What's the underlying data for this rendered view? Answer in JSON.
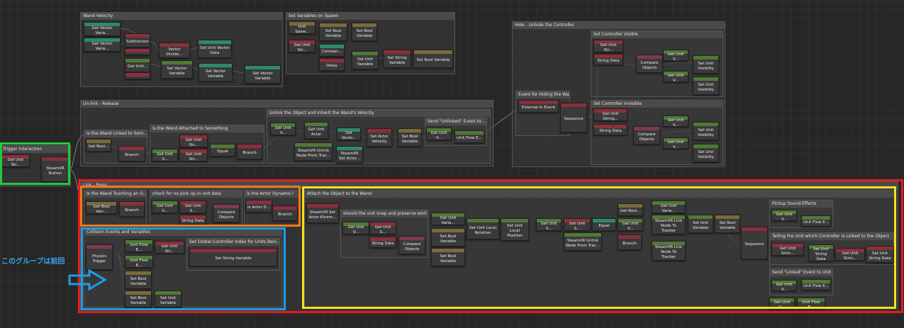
{
  "groups": {
    "wand_velocity": "Wand Velocity",
    "set_vars_spawn": "Set Variables on Spawn",
    "hide_unhide": "Hide - Unhide the Controller",
    "set_controller_visible": "Set Controller Visible",
    "set_controller_invisible": "Set Controller Invisible",
    "unlink_release": "Un-link - Release",
    "is_wand_linked": "Is the Wand Linked to Som...",
    "is_wand_attached": "Is the Wand Attached to Something",
    "unlink_inherit": "Unlink the Object and Inherit the Wand's Velocity",
    "send_unlinked": "Send \"Unlinked\" Event to...",
    "trigger_interaction": "Trigger Interaction",
    "link_press": "Link - Press",
    "is_wand_touching": "Is the Wand Touching an O...",
    "check_no_pickup": "check for no pick up in unit data",
    "is_actor_dynamic": "Is the Actor Dynamic?",
    "attach_object": "Attach the Object to the Wand",
    "should_snap": "should the unit snap and preserve worl...",
    "pickup_sound": "Pickup Sound Effects",
    "telling_unit": "Telling the Unit which Controller is Linked to the Object",
    "send_linked": "Send \"Linked\" Event to Unit",
    "collision": "Collision Events and Variables",
    "set_global_controller": "Set Global Controller Index for Units Bein..."
  },
  "nodes": {
    "get_vector_var": "Get Vector Varia...",
    "get_vector_var2": "Get Vector Varia...",
    "subtraction": "Subtraction",
    "vector_divide": "Vector Divide...",
    "set_unit_vector_data": "Set Unit Vector Data",
    "get_unit": "Get Unit...",
    "set_vector_variable": "Set Vector Variable",
    "unit_spawn": "Unit Spaw...",
    "get_unit_str": "Get Unit Str...",
    "set_bool_variable": "Set Bool Variable",
    "constant": "Constan...",
    "delay": "Delay",
    "set_unit_variable": "Set Unit Variable",
    "set_string_variable": "Set String Variable",
    "set_bool_variable_short": "Set Bool Variable",
    "string_data": "String Data",
    "compare_objects": "Compare Objects",
    "get_unit_v": "Get Unit V...",
    "set_unit_visibility": "Set Unit Visibility",
    "event_hiding": "Event for Hiding the Wand",
    "external_event": "External In Event",
    "sequence": "Sequence",
    "get_unit_string": "Get Unit String...",
    "get_bool": "Get Bool...",
    "branch": "Branch",
    "get_unit_str2": "Get Unit Str...",
    "equal": "Equal",
    "get_unit_actor": "Get Unit Actor",
    "get_vecto": "Get Vecto...",
    "set_actor_velocity": "Set Actor Velocity",
    "steamvr_unlink": "SteamVR Unlink Node From Trac...",
    "steamvr_set_actor": "SteamVR Set Actor...",
    "unit_flow_e": "Unit Flow E...",
    "steamvr_button": "SteamVR Button",
    "get_bool_vari": "Get Bool Vari...",
    "get_unit_s": "Get Unit S...",
    "is_actor_d": "Is Actor D...",
    "steamvr_set_actor_kinem": "SteamVR Set Actor Kinem...",
    "get_unit_varia": "Get Unit Varia...",
    "set_unit_local_rotation": "Set Unit Local Rotation",
    "set_unit_local_position": "Set Unit Local Position",
    "steamvr_link": "SteamVR Link Node To Tracker",
    "get_unit_strin": "Get Unit Strin...",
    "set_unit_string_data": "Set Unit String Data",
    "physics_trigger": "Physics Trigger",
    "unit_flow_e2": "Unit Flow E...",
    "get_unit_str3": "Get Unit Str...",
    "set_string_variable2": "Set String Variable",
    "set_unit_variable2": "Set Unit Variable"
  },
  "annotation": {
    "label": "このグループは前回"
  },
  "colors": {
    "green": "#21c93c",
    "orange": "#f07a1a",
    "red": "#e41c1c",
    "yellow": "#f2e21b",
    "blue": "#1a9fe6"
  }
}
